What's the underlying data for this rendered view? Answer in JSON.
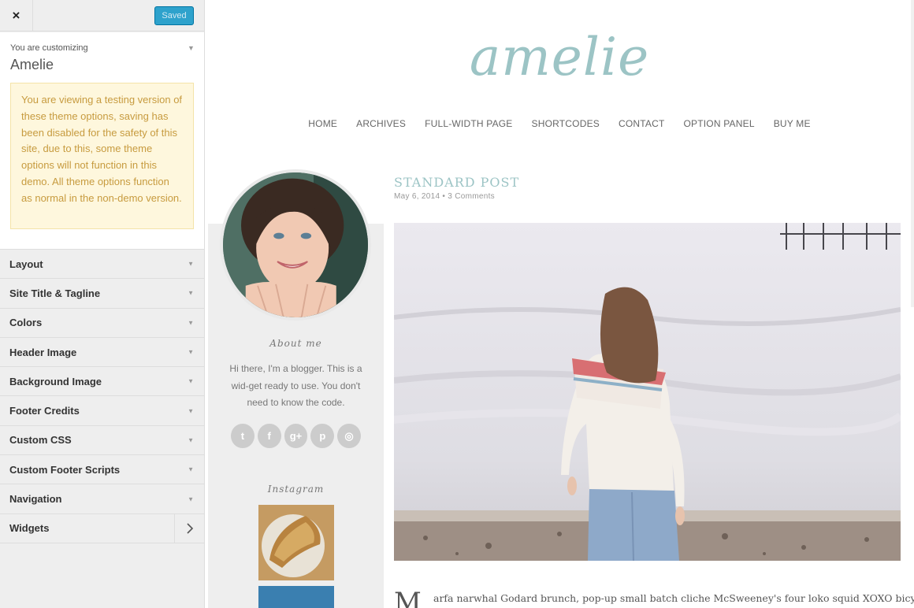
{
  "customizer": {
    "close_label": "×",
    "saved_label": "Saved",
    "customizing_label": "You are customizing",
    "theme_name": "Amelie",
    "notice": "You are viewing a testing version of these theme options, saving has been disabled for the safety of this site, due to this, some theme options will not function in this demo. All theme options function as normal in the non-demo version.",
    "sections": [
      {
        "label": "Layout"
      },
      {
        "label": "Site Title & Tagline"
      },
      {
        "label": "Colors"
      },
      {
        "label": "Header Image"
      },
      {
        "label": "Background Image"
      },
      {
        "label": "Footer Credits"
      },
      {
        "label": "Custom CSS"
      },
      {
        "label": "Custom Footer Scripts"
      },
      {
        "label": "Navigation"
      },
      {
        "label": "Widgets"
      }
    ],
    "colors": {
      "saved_button": "#2ea2cc",
      "notice_bg": "#fef7dd",
      "notice_text": "#c79b3f"
    }
  },
  "site": {
    "logo": "amelie",
    "nav": [
      "HOME",
      "ARCHIVES",
      "FULL-WIDTH PAGE",
      "SHORTCODES",
      "CONTACT",
      "OPTION PANEL",
      "BUY ME"
    ],
    "accent": "#9cc4c5"
  },
  "sidebar": {
    "about_title": "About me",
    "about_text": "Hi there, I'm a blogger. This is a wid-get ready to use. You don't need to know the code.",
    "social_icons": [
      "twitter-icon",
      "facebook-icon",
      "google-plus-icon",
      "pinterest-icon",
      "instagram-icon"
    ],
    "instagram_title": "Instagram"
  },
  "post": {
    "title": "STANDARD POST",
    "meta": "May 6, 2014 • 3 Comments",
    "dropcap": "M",
    "excerpt": "arfa narwhal Godard brunch, pop-up small batch cliche McSweeney's four loko squid XOXO bicycle rights"
  }
}
